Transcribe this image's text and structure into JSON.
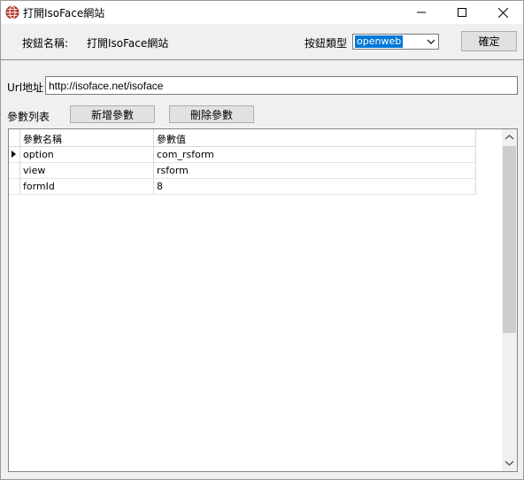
{
  "window": {
    "title": "打開IsoFace網站"
  },
  "header": {
    "button_name_label": "按鈕名稱:",
    "button_name_value": "打開IsoFace網站",
    "button_type_label": "按鈕類型",
    "button_type_value": "openweb",
    "confirm_label": "確定"
  },
  "url": {
    "label": "Url地址",
    "value": "http://isoface.net/isoface"
  },
  "params": {
    "label": "參數列表",
    "add_label": "新增參數",
    "delete_label": "刪除參數",
    "columns": [
      "參數名稱",
      "參數值"
    ],
    "rows": [
      {
        "name": "option",
        "value": "com_rsform"
      },
      {
        "name": "view",
        "value": "rsform"
      },
      {
        "name": "formId",
        "value": "8"
      }
    ]
  }
}
